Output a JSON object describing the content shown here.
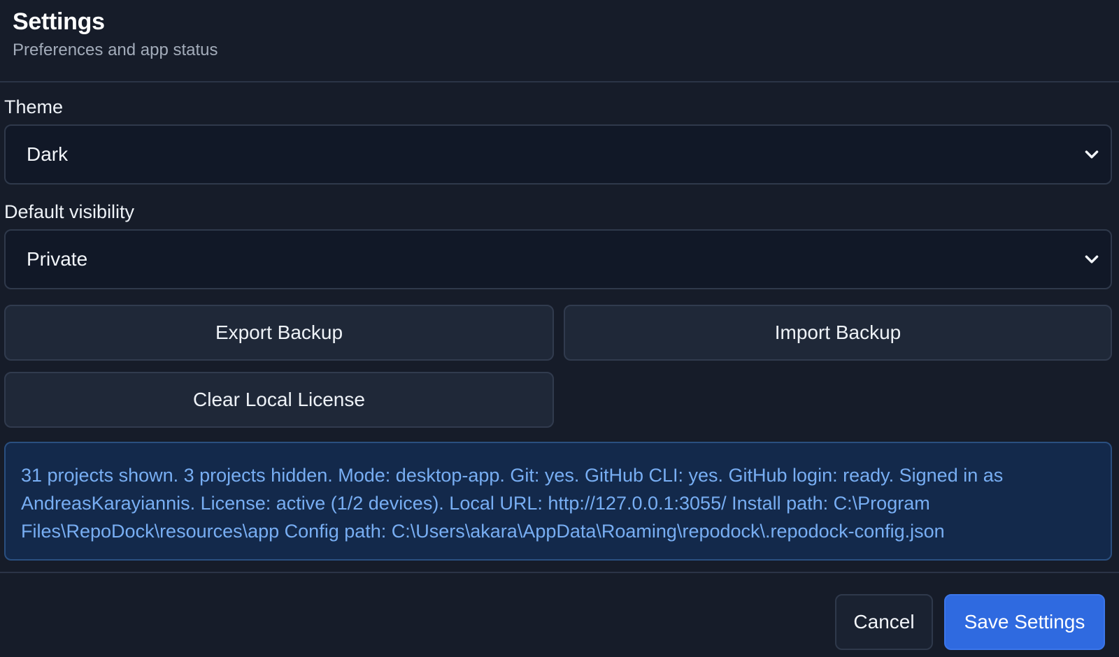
{
  "header": {
    "title": "Settings",
    "subtitle": "Preferences and app status"
  },
  "theme": {
    "label": "Theme",
    "selected": "Dark"
  },
  "visibility": {
    "label": "Default visibility",
    "selected": "Private"
  },
  "actions": {
    "export_label": "Export Backup",
    "import_label": "Import Backup",
    "clear_license_label": "Clear Local License"
  },
  "status": {
    "text": "31 projects shown. 3 projects hidden. Mode: desktop-app. Git: yes. GitHub CLI: yes. GitHub login: ready. Signed in as AndreasKarayiannis. License: active (1/2 devices). Local URL: http://127.0.0.1:3055/ Install path: C:\\Program Files\\RepoDock\\resources\\app Config path: C:\\Users\\akara\\AppData\\Roaming\\repodock\\.repodock-config.json"
  },
  "footer": {
    "cancel_label": "Cancel",
    "save_label": "Save Settings"
  },
  "colors": {
    "background": "#161c29",
    "accent": "#2f6ae0",
    "status_text": "#78aef3",
    "status_background": "#13294b"
  },
  "icons": {
    "dropdown": "chevron-down-icon"
  }
}
